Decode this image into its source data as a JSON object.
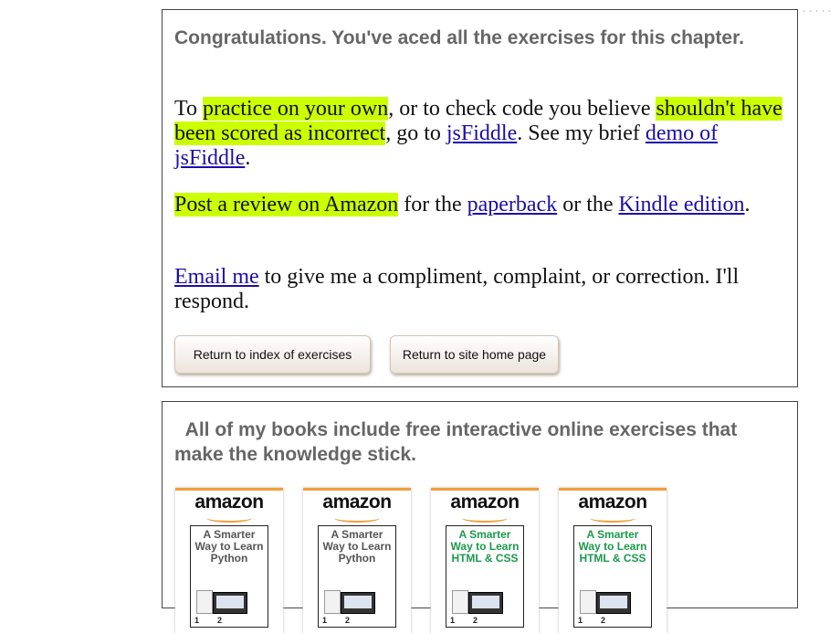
{
  "congrats_heading": "Congratulations. You've aced all the exercises for this chapter.",
  "practice": {
    "t1": "To ",
    "hl1": "practice on your own",
    "t2": ", or to check code you believe ",
    "hl2": "shouldn't have been scored as incorrect",
    "t3": ", go to ",
    "link_jsfiddle": "jsFiddle",
    "t4": ". See my brief ",
    "link_demo": "demo of jsFiddle",
    "t5": "."
  },
  "review": {
    "hl": "Post a review on Amazon",
    "t1": " for the ",
    "link_paperback": "paperback",
    "t2": " or the ",
    "link_kindle": "Kindle edition",
    "t3": "."
  },
  "email": {
    "link": "Email me",
    "text": " to give me a compliment, complaint, or correction. I'll respond."
  },
  "buttons": {
    "index": "Return to index of exercises",
    "home": "Return to site home page"
  },
  "books_heading": "All of my books include free interactive online exercises that make the knowledge stick.",
  "books": [
    {
      "brand": "amazon",
      "title": "A Smarter Way to Learn Python",
      "title_color": "#555555"
    },
    {
      "brand": "amazon",
      "title": "A Smarter Way to Learn Python",
      "title_color": "#555555"
    },
    {
      "brand": "amazon",
      "title": "A Smarter Way to Learn HTML & CSS",
      "title_color": "#1a9a4c"
    },
    {
      "brand": "amazon",
      "title": "A Smarter Way to Learn HTML & CSS",
      "title_color": "#1a9a4c"
    }
  ],
  "colors": {
    "highlight": "#ccff00",
    "link": "#1a0dab",
    "amazon_orange": "#f19e39"
  }
}
